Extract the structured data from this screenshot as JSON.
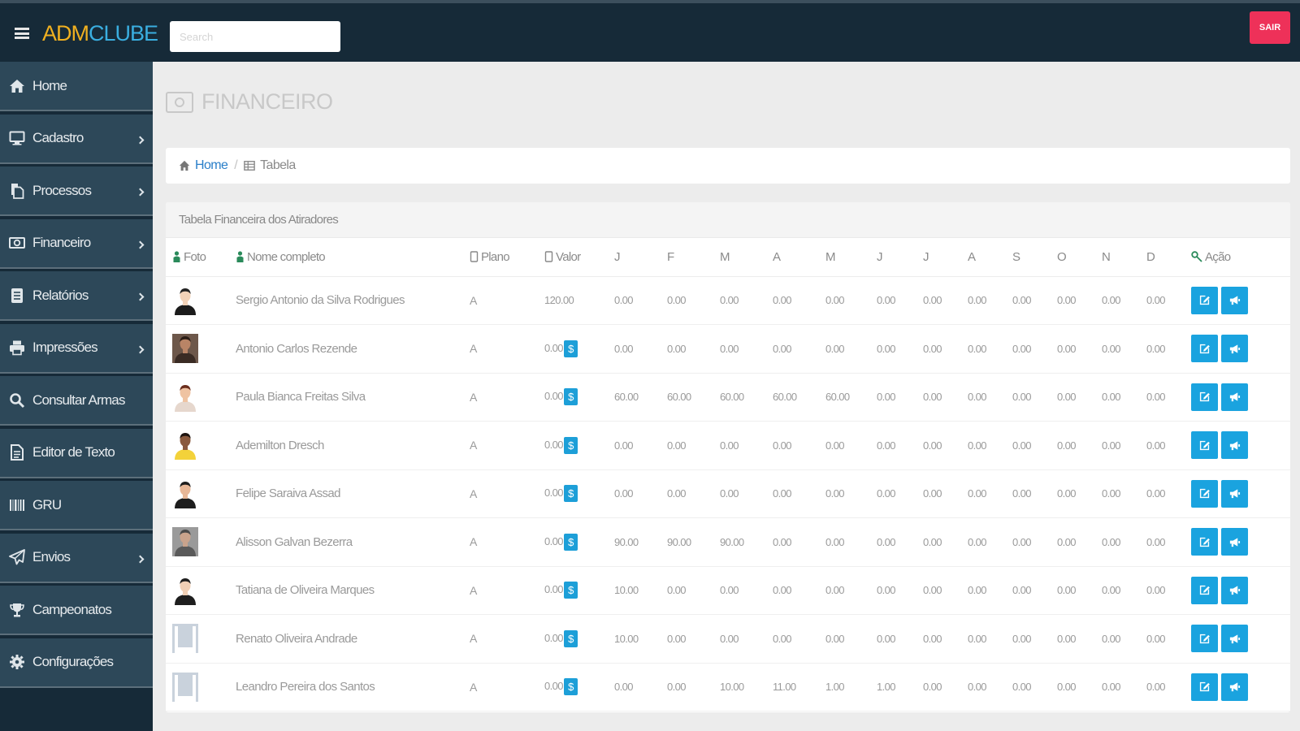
{
  "topbar": {
    "brand_part1": "ADM",
    "brand_part2": "CLUBE",
    "search_placeholder": "Search",
    "logout_label": "SAIR"
  },
  "sidebar": {
    "items": [
      {
        "label": "Home",
        "icon": "home-icon",
        "has_submenu": false
      },
      {
        "label": "Cadastro",
        "icon": "monitor-icon",
        "has_submenu": true
      },
      {
        "label": "Processos",
        "icon": "files-icon",
        "has_submenu": true
      },
      {
        "label": "Financeiro",
        "icon": "money-icon",
        "has_submenu": true
      },
      {
        "label": "Relatórios",
        "icon": "report-icon",
        "has_submenu": true
      },
      {
        "label": "Impressões",
        "icon": "print-icon",
        "has_submenu": true
      },
      {
        "label": "Consultar Armas",
        "icon": "search-icon",
        "has_submenu": false
      },
      {
        "label": "Editor de Texto",
        "icon": "document-icon",
        "has_submenu": false
      },
      {
        "label": "GRU",
        "icon": "barcode-icon",
        "has_submenu": false
      },
      {
        "label": "Envios",
        "icon": "paper-plane-icon",
        "has_submenu": true
      },
      {
        "label": "Campeonatos",
        "icon": "trophy-icon",
        "has_submenu": false
      },
      {
        "label": "Configurações",
        "icon": "gear-icon",
        "has_submenu": false
      }
    ]
  },
  "page": {
    "title": "FINANCEIRO",
    "title_icon": "money-icon"
  },
  "breadcrumb": {
    "home": "Home",
    "current": "Tabela"
  },
  "panel": {
    "title": "Tabela Financeira dos Atiradores"
  },
  "table": {
    "headers": {
      "foto": "Foto",
      "nome": "Nome completo",
      "plano": "Plano",
      "valor": "Valor",
      "months": [
        "J",
        "F",
        "M",
        "A",
        "M",
        "J",
        "J",
        "A",
        "S",
        "O",
        "N",
        "D"
      ],
      "acao": "Ação"
    },
    "rows": [
      {
        "name": "Sergio Antonio da Silva Rodrigues",
        "plano": "A",
        "valor": "120.00",
        "has_badge": false,
        "months": [
          "0.00",
          "0.00",
          "0.00",
          "0.00",
          "0.00",
          "0.00",
          "0.00",
          "0.00",
          "0.00",
          "0.00",
          "0.00",
          "0.00"
        ],
        "avatar": {
          "skin": "#f2d2b8",
          "hair": "#222",
          "shirt": "#1b1b1b",
          "bg": "#ffffff",
          "placeholder": false
        }
      },
      {
        "name": "Antonio Carlos Rezende",
        "plano": "A",
        "valor": "0.00",
        "has_badge": true,
        "months": [
          "0.00",
          "0.00",
          "0.00",
          "0.00",
          "0.00",
          "0.00",
          "0.00",
          "0.00",
          "0.00",
          "0.00",
          "0.00",
          "0.00"
        ],
        "avatar": {
          "skin": "#b98466",
          "hair": "#2a1c15",
          "shirt": "#3a2b24",
          "bg": "#6d574a",
          "placeholder": false
        }
      },
      {
        "name": "Paula Bianca Freitas Silva",
        "plano": "A",
        "valor": "0.00",
        "has_badge": true,
        "months": [
          "60.00",
          "60.00",
          "60.00",
          "60.00",
          "60.00",
          "0.00",
          "0.00",
          "0.00",
          "0.00",
          "0.00",
          "0.00",
          "0.00"
        ],
        "avatar": {
          "skin": "#efc3a2",
          "hair": "#6b2e1d",
          "shirt": "#e6d7cd",
          "bg": "#ffffff",
          "placeholder": false
        }
      },
      {
        "name": "Ademilton Dresch",
        "plano": "A",
        "valor": "0.00",
        "has_badge": true,
        "months": [
          "0.00",
          "0.00",
          "0.00",
          "0.00",
          "0.00",
          "0.00",
          "0.00",
          "0.00",
          "0.00",
          "0.00",
          "0.00",
          "0.00"
        ],
        "avatar": {
          "skin": "#8a5a3e",
          "hair": "#1e1410",
          "shirt": "#f3d23a",
          "bg": "#ffffff",
          "placeholder": false
        }
      },
      {
        "name": "Felipe Saraiva Assad",
        "plano": "A",
        "valor": "0.00",
        "has_badge": true,
        "months": [
          "0.00",
          "0.00",
          "0.00",
          "0.00",
          "0.00",
          "0.00",
          "0.00",
          "0.00",
          "0.00",
          "0.00",
          "0.00",
          "0.00"
        ],
        "avatar": {
          "skin": "#e7b797",
          "hair": "#1d1d1d",
          "shirt": "#1d1d1d",
          "bg": "#ffffff",
          "placeholder": false
        }
      },
      {
        "name": "Alisson Galvan Bezerra",
        "plano": "A",
        "valor": "0.00",
        "has_badge": true,
        "months": [
          "90.00",
          "90.00",
          "90.00",
          "0.00",
          "0.00",
          "0.00",
          "0.00",
          "0.00",
          "0.00",
          "0.00",
          "0.00",
          "0.00"
        ],
        "avatar": {
          "skin": "#c9a38c",
          "hair": "#4a4a4a",
          "shirt": "#5a5a5a",
          "bg": "#9a9a9a",
          "placeholder": false
        }
      },
      {
        "name": "Tatiana de Oliveira Marques",
        "plano": "A",
        "valor": "0.00",
        "has_badge": true,
        "months": [
          "10.00",
          "0.00",
          "0.00",
          "0.00",
          "0.00",
          "0.00",
          "0.00",
          "0.00",
          "0.00",
          "0.00",
          "0.00",
          "0.00"
        ],
        "avatar": {
          "skin": "#f0cfb5",
          "hair": "#1e1e1e",
          "shirt": "#1e1e1e",
          "bg": "#ffffff",
          "placeholder": false
        }
      },
      {
        "name": "Renato Oliveira Andrade",
        "plano": "A",
        "valor": "0.00",
        "has_badge": true,
        "months": [
          "10.00",
          "0.00",
          "0.00",
          "0.00",
          "0.00",
          "0.00",
          "0.00",
          "0.00",
          "0.00",
          "0.00",
          "0.00",
          "0.00"
        ],
        "avatar": {
          "skin": "#ffffff",
          "hair": "#ffffff",
          "shirt": "#ffffff",
          "bg": "#c9d2dc",
          "placeholder": true
        }
      },
      {
        "name": "Leandro Pereira dos Santos",
        "plano": "A",
        "valor": "0.00",
        "has_badge": true,
        "months": [
          "0.00",
          "0.00",
          "10.00",
          "11.00",
          "1.00",
          "1.00",
          "0.00",
          "0.00",
          "0.00",
          "0.00",
          "0.00",
          "0.00"
        ],
        "avatar": {
          "skin": "#ffffff",
          "hair": "#ffffff",
          "shirt": "#ffffff",
          "bg": "#c9d2dc",
          "placeholder": true
        }
      }
    ],
    "badge_symbol": "$",
    "action_icons": [
      "edit-icon",
      "megaphone-icon"
    ]
  },
  "colors": {
    "topbar_bg": "#162a38",
    "sidebar_item_bg": "#2d4859",
    "accent_blue": "#1aa3df",
    "logout_red": "#ee3159",
    "brand_gold": "#f0b020",
    "brand_blue": "#3aaee0"
  }
}
